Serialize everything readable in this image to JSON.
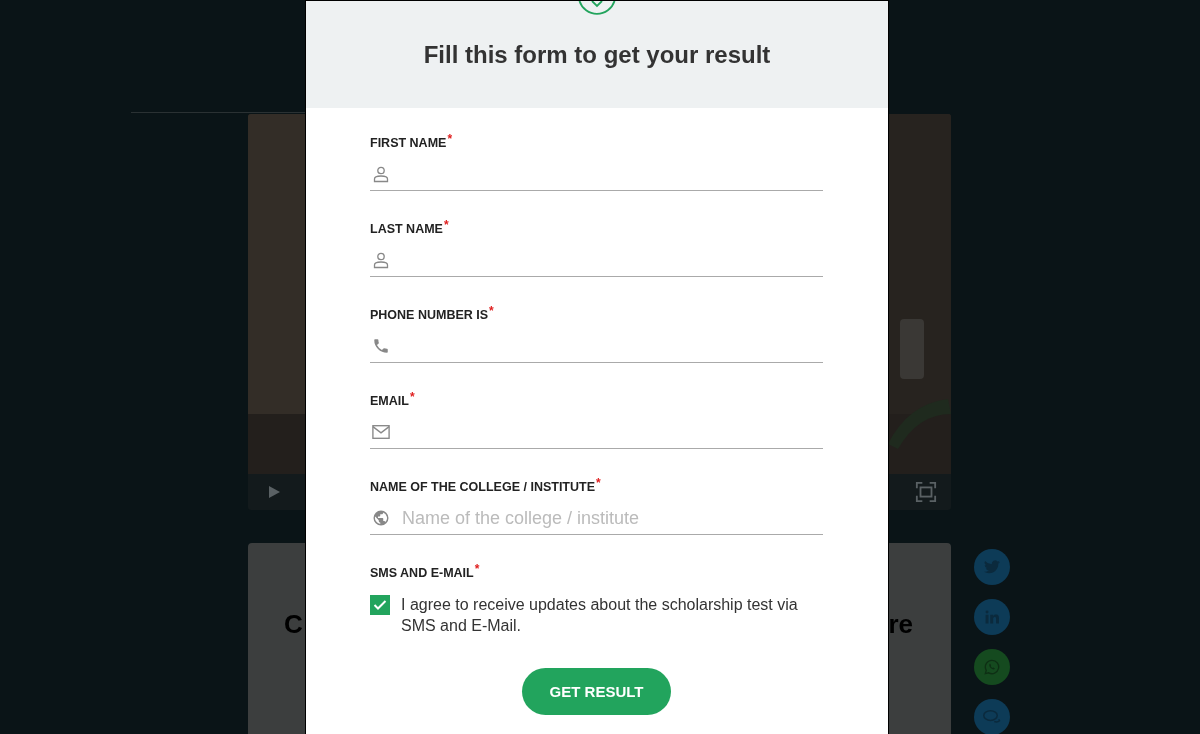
{
  "background": {
    "card": {
      "text_left": "C",
      "text_right": "re"
    },
    "share_buttons": [
      {
        "kind": "twitter",
        "color": "#0d3b57"
      },
      {
        "kind": "linkedin",
        "color": "#0d3b57"
      },
      {
        "kind": "whatsapp",
        "color": "#154a1f"
      },
      {
        "kind": "chat",
        "color": "#0d3b57"
      }
    ]
  },
  "modal": {
    "title": "Fill this form to get your result",
    "fields": [
      {
        "label": "FIRST NAME",
        "required_mark": "*",
        "kind": "person"
      },
      {
        "label": "LAST NAME",
        "required_mark": "*",
        "kind": "person"
      },
      {
        "label": "PHONE NUMBER IS",
        "required_mark": "*",
        "kind": "phone"
      },
      {
        "label": "EMAIL",
        "required_mark": "*",
        "kind": "email"
      },
      {
        "label": "NAME OF THE COLLEGE / INSTITUTE",
        "required_mark": "*",
        "kind": "globe",
        "placeholder": "Name of the college / institute"
      }
    ],
    "consent": {
      "label": "SMS AND E-MAIL",
      "required_mark": "*",
      "checked": true,
      "text": "I agree to receive updates about the scholarship test via SMS and E-Mail."
    },
    "submit": "GET RESULT"
  }
}
